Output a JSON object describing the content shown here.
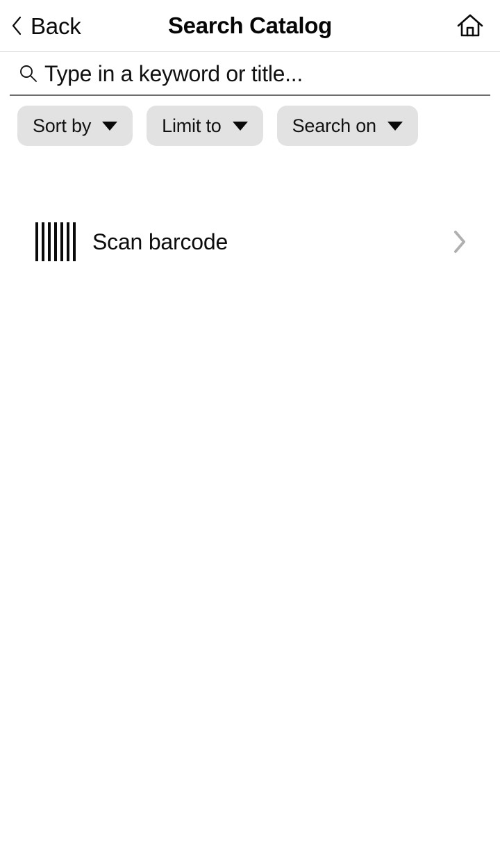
{
  "header": {
    "back_label": "Back",
    "title": "Search Catalog",
    "back_icon": "chevron-left-icon",
    "home_icon": "home-icon"
  },
  "search": {
    "placeholder": "Type in a keyword or title...",
    "value": "",
    "icon": "search-icon"
  },
  "filters": {
    "chips": [
      {
        "label": "Sort by",
        "icon": "chevron-down-icon"
      },
      {
        "label": "Limit to",
        "icon": "chevron-down-icon"
      },
      {
        "label": "Search on",
        "icon": "chevron-down-icon"
      }
    ]
  },
  "list": {
    "items": [
      {
        "label": "Scan barcode",
        "leading_icon": "barcode-icon",
        "trailing_icon": "chevron-right-icon"
      }
    ]
  },
  "colors": {
    "background": "#ffffff",
    "text": "#111111",
    "chip_background": "#e2e2e2",
    "divider": "#d8d8d8",
    "input_underline": "#6e6e6e",
    "chevron_gray": "#b0b0b0"
  }
}
